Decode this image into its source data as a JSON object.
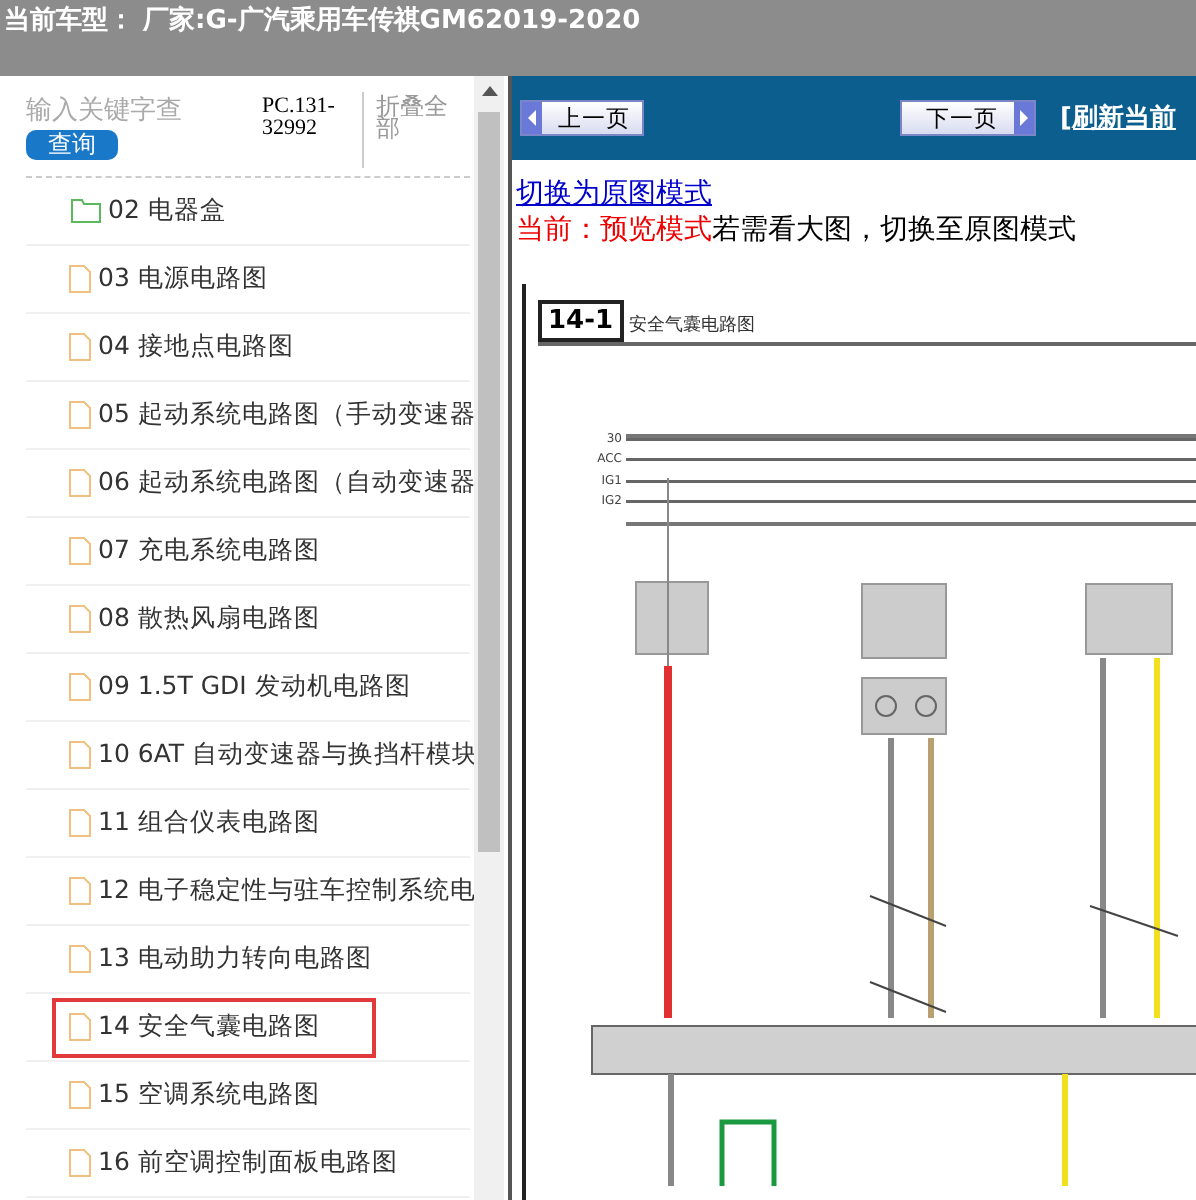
{
  "header": {
    "title": "当前车型： 厂家:G-广汽乘用车传祺GM62019-2020"
  },
  "sidebar": {
    "search": {
      "placeholder": "输入关键字查"
    },
    "search_button": "查询",
    "code": "PC.131-32992",
    "collapse_all": "折叠全部",
    "items": [
      {
        "kind": "folder",
        "label": "02 电器盒",
        "selected": false
      },
      {
        "kind": "file",
        "label": "03 电源电路图",
        "selected": false
      },
      {
        "kind": "file",
        "label": "04 接地点电路图",
        "selected": false
      },
      {
        "kind": "file",
        "label": "05 起动系统电路图（手动变速器",
        "selected": false
      },
      {
        "kind": "file",
        "label": "06 起动系统电路图（自动变速器",
        "selected": false
      },
      {
        "kind": "file",
        "label": "07 充电系统电路图",
        "selected": false
      },
      {
        "kind": "file",
        "label": "08 散热风扇电路图",
        "selected": false
      },
      {
        "kind": "file",
        "label": "09 1.5T GDI 发动机电路图",
        "selected": false
      },
      {
        "kind": "file",
        "label": "10 6AT 自动变速器与换挡杆模块",
        "selected": false
      },
      {
        "kind": "file",
        "label": "11 组合仪表电路图",
        "selected": false
      },
      {
        "kind": "file",
        "label": "12 电子稳定性与驻车控制系统电",
        "selected": false
      },
      {
        "kind": "file",
        "label": "13 电动助力转向电路图",
        "selected": false
      },
      {
        "kind": "file",
        "label": "14 安全气囊电路图",
        "selected": true
      },
      {
        "kind": "file",
        "label": "15 空调系统电路图",
        "selected": false
      },
      {
        "kind": "file",
        "label": "16 前空调控制面板电路图",
        "selected": false
      }
    ]
  },
  "toolbar": {
    "prev": "上一页",
    "next": "下一页",
    "refresh": "[刷新当前"
  },
  "mode": {
    "switch_link": "切换为原图模式",
    "current": "当前：预览模式",
    "hint": "若需看大图，切换至原图模式"
  },
  "diagram": {
    "number": "14-1",
    "title": "安全气囊电路图",
    "bus_lines": [
      "30",
      "ACC",
      "IG1",
      "IG2"
    ]
  }
}
